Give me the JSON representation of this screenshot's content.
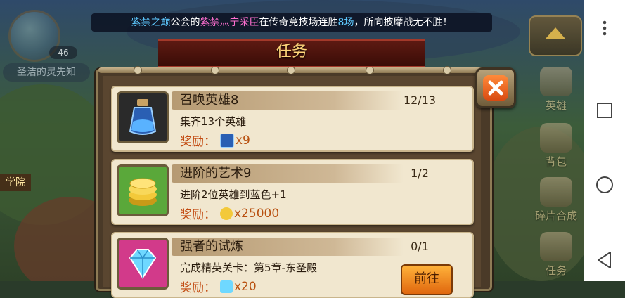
{
  "ticker": {
    "p1": "紫禁之巅",
    "p2": "公会的",
    "p3": "紫禁灬宁采臣",
    "p4": "在传奇竞技场连胜",
    "p5": "8场",
    "p6": "，所向披靡战无不胜！"
  },
  "player": {
    "level": "46",
    "hero_name": "圣洁的灵先知",
    "academy": "学院"
  },
  "panel": {
    "title": "任务"
  },
  "side_buttons": [
    {
      "label": "英雄"
    },
    {
      "label": "背包"
    },
    {
      "label": "碎片合成"
    },
    {
      "label": "任务"
    }
  ],
  "reward_label": "奖励：",
  "tasks": [
    {
      "name": "召唤英雄8",
      "progress": "12/13",
      "desc": "集齐13个英雄",
      "amount": "x9",
      "icon": "potion-bottle-icon"
    },
    {
      "name": "进阶的艺术9",
      "progress": "1/2",
      "desc": "进阶2位英雄到蓝色+1",
      "amount": "x25000",
      "icon": "gold-coins-icon"
    },
    {
      "name": "强者的试炼",
      "progress": "0/1",
      "desc": "完成精英关卡：第5章-东圣殿",
      "amount": "x20",
      "icon": "diamond-icon",
      "action": "前往"
    }
  ],
  "colors": {
    "accent": "#ffd67a",
    "reward": "#c24a10",
    "close": "#d84a12"
  }
}
